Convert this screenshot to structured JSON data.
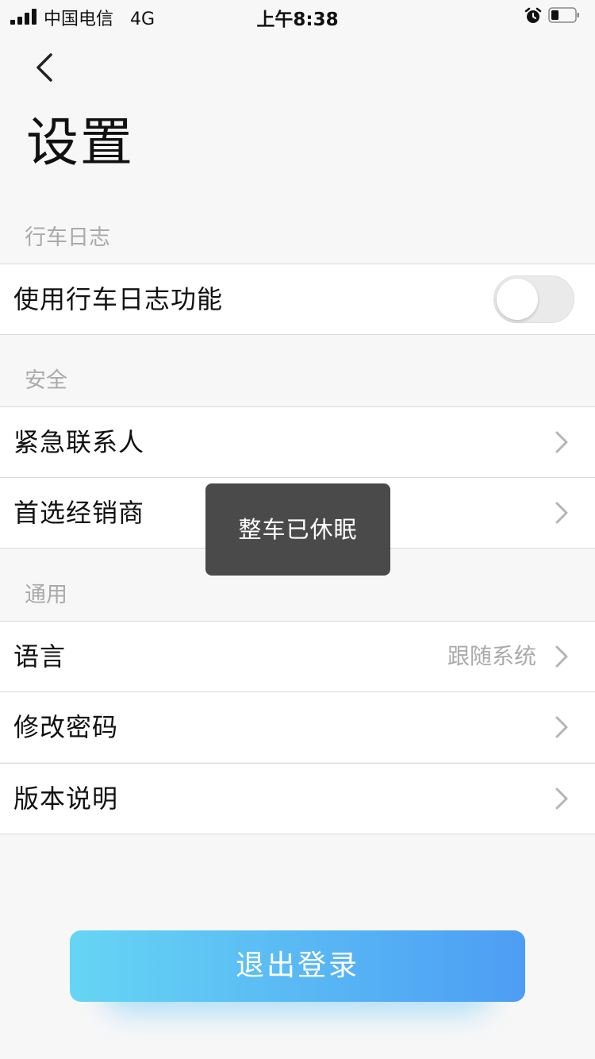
{
  "status_bar": {
    "carrier": "中国电信",
    "network": "4G",
    "time": "上午8:38"
  },
  "nav": {
    "back_icon": "chevron-left-icon"
  },
  "page": {
    "title": "设置"
  },
  "sections": {
    "driving_log": {
      "header": "行车日志",
      "items": [
        {
          "label": "使用行车日志功能",
          "control": "toggle",
          "enabled": false
        }
      ]
    },
    "safety": {
      "header": "安全",
      "items": [
        {
          "label": "紧急联系人",
          "control": "chevron-right-icon"
        },
        {
          "label": "首选经销商",
          "control": "chevron-right-icon"
        }
      ]
    },
    "general": {
      "header": "通用",
      "items": [
        {
          "label": "语言",
          "value": "跟随系统",
          "control": "chevron-right-icon"
        },
        {
          "label": "修改密码",
          "control": "chevron-right-icon"
        },
        {
          "label": "版本说明",
          "control": "chevron-right-icon"
        }
      ]
    }
  },
  "toast": {
    "message": "整车已休眠"
  },
  "logout": {
    "label": "退出登录"
  },
  "colors": {
    "background": "#f7f7f7",
    "row_background": "#ffffff",
    "divider": "#d9d9d9",
    "muted_text": "#aaaaaa",
    "toast_background": "#4a4a4a",
    "button_gradient_start": "#66d5f4",
    "button_gradient_end": "#4d9df4"
  }
}
